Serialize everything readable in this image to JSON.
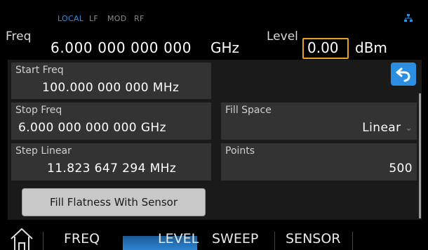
{
  "status": {
    "local": "LOCAL",
    "lf": "LF",
    "mod": "MOD",
    "rf": "RF",
    "network_icon": "network-icon"
  },
  "header": {
    "freq_label": "Freq",
    "freq_value": "6.000 000 000 000",
    "freq_unit": "GHz",
    "level_label": "Level",
    "level_value": "0.00",
    "level_unit": "dBm"
  },
  "fields": {
    "start_freq": {
      "label": "Start Freq",
      "value": "100.000 000 000 MHz"
    },
    "stop_freq": {
      "label": "Stop Freq",
      "value": "6.000 000 000 000 GHz"
    },
    "step_linear": {
      "label": "Step Linear",
      "value": "11.823 647 294 MHz"
    },
    "fill_space": {
      "label": "Fill Space",
      "value": "Linear"
    },
    "points": {
      "label": "Points",
      "value": "500"
    }
  },
  "buttons": {
    "fill_with_sensor": "Fill Flatness With Sensor"
  },
  "tabs": [
    {
      "label": "FREQ"
    },
    {
      "label": "LEVEL",
      "active": true
    },
    {
      "label": "SWEEP"
    },
    {
      "label": "SENSOR"
    }
  ],
  "colors": {
    "accent_blue": "#2a8fe0",
    "level_highlight": "#e8a020",
    "field_bg": "#333333"
  }
}
